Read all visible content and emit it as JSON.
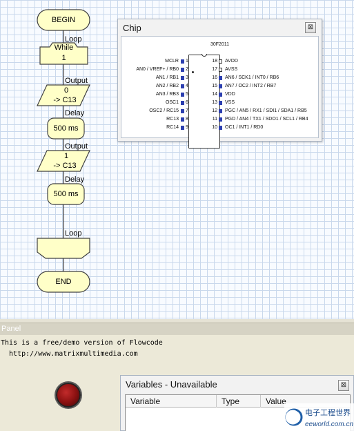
{
  "flowchart": {
    "begin": "BEGIN",
    "loop_start_label": "Loop",
    "while_line1": "While",
    "while_line2": "1",
    "output1_label": "Output",
    "output1_line1": "0",
    "output1_line2": "-> C13",
    "delay1_label": "Delay",
    "delay1_text": "500 ms",
    "output2_label": "Output",
    "output2_line1": "1",
    "output2_line2": "-> C13",
    "delay2_label": "Delay",
    "delay2_text": "500 ms",
    "loop_end_label": "Loop",
    "end": "END"
  },
  "chip": {
    "title": "Chip",
    "close_glyph": "⊠",
    "part": "30F2011",
    "pins_left": [
      {
        "num": "1",
        "label": "MCLR"
      },
      {
        "num": "2",
        "label": "AN0 / VREF+ / RB0"
      },
      {
        "num": "3",
        "label": "AN1 / RB1"
      },
      {
        "num": "4",
        "label": "AN2 / RB2"
      },
      {
        "num": "5",
        "label": "AN3 / RB3"
      },
      {
        "num": "6",
        "label": "OSC1"
      },
      {
        "num": "7",
        "label": "OSC2 / RC15"
      },
      {
        "num": "8",
        "label": "RC13"
      },
      {
        "num": "9",
        "label": "RC14"
      }
    ],
    "pins_right": [
      {
        "num": "18",
        "label": "AVDD"
      },
      {
        "num": "17",
        "label": "AVSS"
      },
      {
        "num": "16",
        "label": "AN6 / SCK1 / INT0 / RB6"
      },
      {
        "num": "15",
        "label": "AN7 / OC2 / INT2 / RB7"
      },
      {
        "num": "14",
        "label": "VDD"
      },
      {
        "num": "13",
        "label": "VSS"
      },
      {
        "num": "12",
        "label": "PGC / AN5 / RX1 / SDI1 / SDA1 / RB5"
      },
      {
        "num": "11",
        "label": "PGD / AN4 / TX1 / SDO1 / SCL1 / RB4"
      },
      {
        "num": "10",
        "label": "OC1 / INT1 / RD0"
      }
    ]
  },
  "panel": {
    "title": "Panel",
    "text": "This is a free/demo version of Flowcode\n  http://www.matrixmultimedia.com"
  },
  "variables": {
    "title": "Variables - Unavailable",
    "close_glyph": "⊠",
    "columns": [
      "Variable",
      "Type",
      "Value"
    ]
  },
  "watermark": {
    "cn": "电子工程世界",
    "en": "eeworld.com.cn"
  },
  "colors": {
    "block_fill": "#ffffc8",
    "block_stroke": "#404040",
    "led": "#8e1212",
    "pin_blue": "#2c3fb0"
  }
}
